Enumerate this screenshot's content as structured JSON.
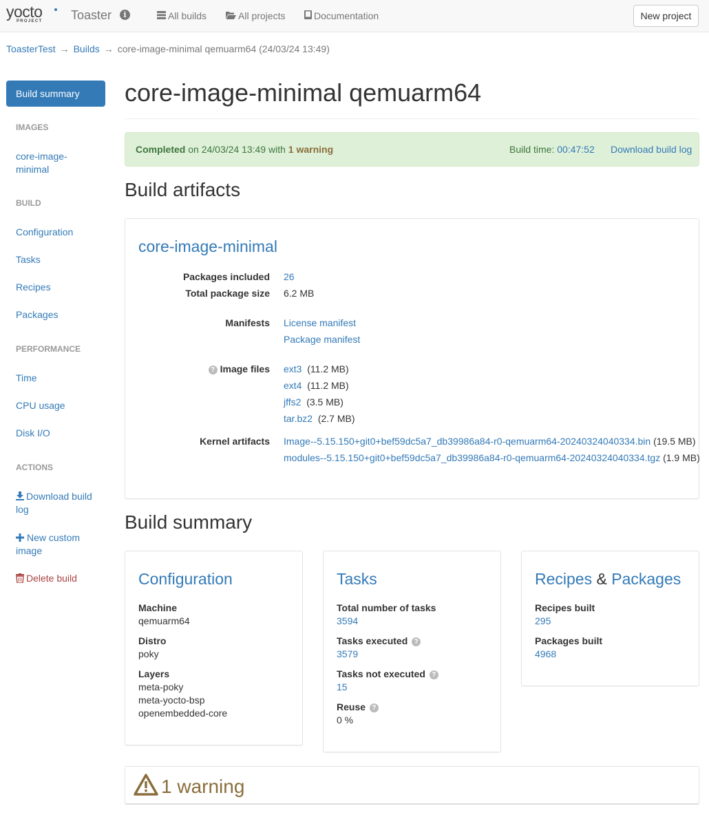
{
  "navbar": {
    "logo_main": "yocto",
    "logo_sub": "PROJECT",
    "app_title": "Toaster",
    "info_icon": "info-icon",
    "links": [
      {
        "label": "All builds",
        "icon": "list-icon"
      },
      {
        "label": "All projects",
        "icon": "folder-open-icon"
      },
      {
        "label": "Documentation",
        "icon": "book-icon"
      }
    ],
    "new_project_label": "New project"
  },
  "breadcrumb": {
    "project": "ToasterTest",
    "builds": "Builds",
    "current": "core-image-minimal qemuarm64 (24/03/24 13:49)",
    "separator": "→"
  },
  "sidebar": {
    "active_item": "Build summary",
    "images_header": "IMAGES",
    "image_item_line1": "core-image-",
    "image_item_line2": "minimal",
    "build_header": "BUILD",
    "build_items": [
      "Configuration",
      "Tasks",
      "Recipes",
      "Packages"
    ],
    "performance_header": "PERFORMANCE",
    "performance_items": [
      "Time",
      "CPU usage",
      "Disk I/O"
    ],
    "actions_header": "ACTIONS",
    "download_line1": "Download build",
    "download_line2": "log",
    "custom_line1": "New custom",
    "custom_line2": "image",
    "delete_label": "Delete build"
  },
  "page": {
    "title": "core-image-minimal qemuarm64"
  },
  "status": {
    "completed": "Completed",
    "on_text": "on 24/03/24 13:49 with",
    "warning_text": "1 warning",
    "build_time_label": "Build time:",
    "build_time": "00:47:52",
    "download_log": "Download build log",
    "colors": {
      "background": "#dff0d8",
      "text": "#3c763d",
      "warning": "#8a6d3b"
    }
  },
  "artifacts": {
    "section_title": "Build artifacts",
    "image_name": "core-image-minimal",
    "packages_included_label": "Packages included",
    "packages_included": "26",
    "total_size_label": "Total package size",
    "total_size": "6.2 MB",
    "manifests_label": "Manifests",
    "license_manifest": "License manifest",
    "package_manifest": "Package manifest",
    "image_files_label": "Image files",
    "image_files": [
      {
        "name": "ext3",
        "size": "(11.2 MB)"
      },
      {
        "name": "ext4",
        "size": "(11.2 MB)"
      },
      {
        "name": "jffs2",
        "size": "(3.5 MB)"
      },
      {
        "name": "tar.bz2",
        "size": "(2.7 MB)"
      }
    ],
    "kernel_label": "Kernel artifacts",
    "kernel_files": [
      {
        "name": "Image--5.15.150+git0+bef59dc5a7_db39986a84-r0-qemuarm64-20240324040334.bin",
        "size": "(19.5 MB)"
      },
      {
        "name": "modules--5.15.150+git0+bef59dc5a7_db39986a84-r0-qemuarm64-20240324040334.tgz",
        "size": "(1.9 MB)"
      }
    ]
  },
  "summary": {
    "section_title": "Build summary",
    "configuration": {
      "title": "Configuration",
      "machine_label": "Machine",
      "machine": "qemuarm64",
      "distro_label": "Distro",
      "distro": "poky",
      "layers_label": "Layers",
      "layers": [
        "meta-poky",
        "meta-yocto-bsp",
        "openembedded-core"
      ]
    },
    "tasks": {
      "title": "Tasks",
      "total_label": "Total number of tasks",
      "total": "3594",
      "executed_label": "Tasks executed",
      "executed": "3579",
      "not_executed_label": "Tasks not executed",
      "not_executed": "15",
      "reuse_label": "Reuse",
      "reuse": "0 %"
    },
    "recipes_packages": {
      "title_recipes": "Recipes",
      "title_amp": "&",
      "title_packages": "Packages",
      "recipes_label": "Recipes built",
      "recipes": "295",
      "packages_label": "Packages built",
      "packages": "4968"
    }
  },
  "warnings": {
    "title": "1 warning",
    "icon": "warning-triangle-icon"
  }
}
